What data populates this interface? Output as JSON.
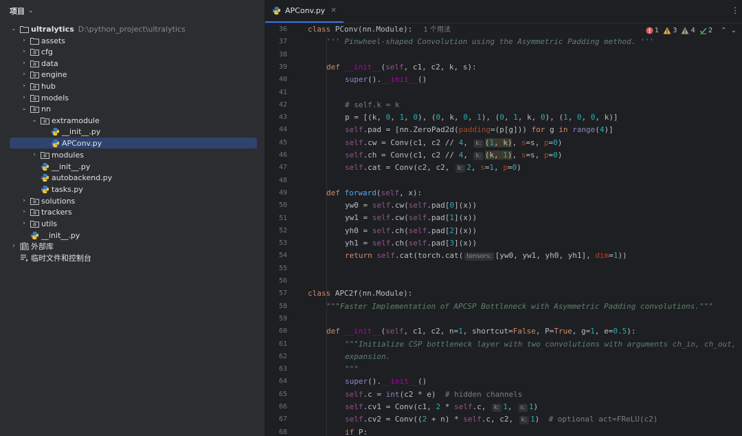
{
  "project": {
    "title": "项目",
    "tree": [
      {
        "label": "ultralytics",
        "path": "D:\\python_project\\ultralytics",
        "icon": "folder-icon",
        "arrow": "⌄",
        "level": 0,
        "bold": true
      },
      {
        "label": "assets",
        "icon": "folder-icon",
        "arrow": "›",
        "level": 1
      },
      {
        "label": "cfg",
        "icon": "package-icon",
        "arrow": "›",
        "level": 1
      },
      {
        "label": "data",
        "icon": "package-icon",
        "arrow": "›",
        "level": 1
      },
      {
        "label": "engine",
        "icon": "package-icon",
        "arrow": "›",
        "level": 1
      },
      {
        "label": "hub",
        "icon": "package-icon",
        "arrow": "›",
        "level": 1
      },
      {
        "label": "models",
        "icon": "package-icon",
        "arrow": "›",
        "level": 1
      },
      {
        "label": "nn",
        "icon": "package-icon",
        "arrow": "⌄",
        "level": 1
      },
      {
        "label": "extramodule",
        "icon": "package-icon",
        "arrow": "⌄",
        "level": 2
      },
      {
        "label": "__init__.py",
        "icon": "python-file-icon",
        "arrow": "",
        "level": 3
      },
      {
        "label": "APConv.py",
        "icon": "python-file-icon",
        "arrow": "",
        "level": 3,
        "selected": true
      },
      {
        "label": "modules",
        "icon": "package-icon",
        "arrow": "›",
        "level": 2
      },
      {
        "label": "__init__.py",
        "icon": "python-file-icon",
        "arrow": "",
        "level": 2
      },
      {
        "label": "autobackend.py",
        "icon": "python-file-icon",
        "arrow": "",
        "level": 2
      },
      {
        "label": "tasks.py",
        "icon": "python-file-icon",
        "arrow": "",
        "level": 2
      },
      {
        "label": "solutions",
        "icon": "package-icon",
        "arrow": "›",
        "level": 1
      },
      {
        "label": "trackers",
        "icon": "package-icon",
        "arrow": "›",
        "level": 1
      },
      {
        "label": "utils",
        "icon": "package-icon",
        "arrow": "›",
        "level": 1
      },
      {
        "label": "__init__.py",
        "icon": "python-file-icon",
        "arrow": "",
        "level": 1
      },
      {
        "label": "外部库",
        "icon": "library-icon",
        "arrow": "›",
        "level": 0
      },
      {
        "label": "临时文件和控制台",
        "icon": "scratches-icon",
        "arrow": "",
        "level": 0
      }
    ]
  },
  "editor": {
    "tab_label": "APConv.py",
    "usage_hint": "1 个用法",
    "inspections": {
      "errors": "1",
      "warnings": "3",
      "weak_warnings": "4",
      "ok": "2"
    },
    "line_numbers": [
      "36",
      "37",
      "38",
      "39",
      "40",
      "41",
      "42",
      "43",
      "44",
      "45",
      "46",
      "47",
      "48",
      "49",
      "50",
      "51",
      "52",
      "53",
      "54",
      "55",
      "56",
      "57",
      "58",
      "59",
      "60",
      "61",
      "62",
      "63",
      "64",
      "65",
      "66",
      "67",
      "68"
    ],
    "hint_labels": {
      "k": "k:",
      "s": "s:",
      "tensors": "tensors:"
    }
  },
  "colors": {
    "accent": "#3574f0",
    "keyword": "#cf8e6d",
    "function": "#56a8f5",
    "self": "#94558d",
    "number": "#2aacb8",
    "docstring": "#5f826b",
    "error": "#db5c5c",
    "warning": "#e2a73d"
  }
}
